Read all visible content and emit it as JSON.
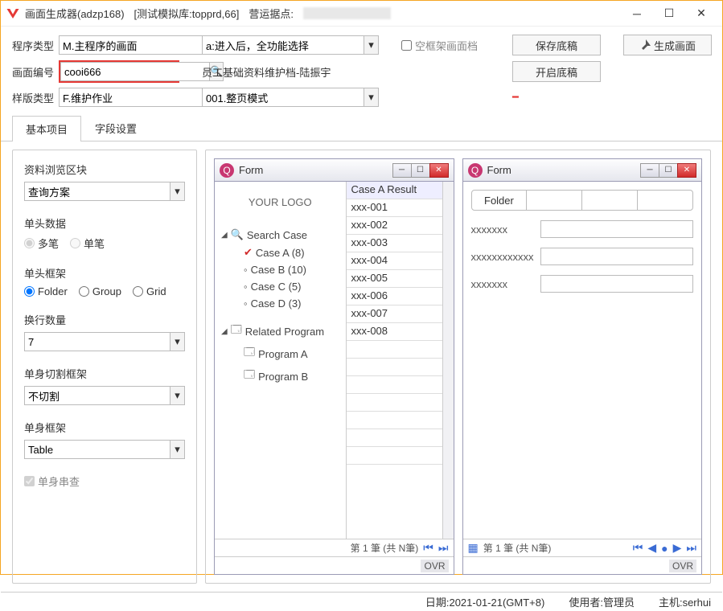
{
  "title": "画面生成器(adzp168)",
  "title_info1": "[测试模拟库:topprd,66]",
  "title_info2": "营运据点:",
  "form": {
    "progtype_lbl": "程序类型",
    "progtype_val": "M.主程序的画面",
    "entry_val": "a:进入后，全功能选择",
    "chk_empty": "空框架画面档",
    "btn_savedraft": "保存底稿",
    "btn_gen": "生成画面",
    "scrno_lbl": "画面编号",
    "scrno_val": "cooi666",
    "staff_lbl": "员工基础资料维护档-陆振宇",
    "btn_opendraft": "开启底稿",
    "tpltype_lbl": "样版类型",
    "tpltype_val": "F.维护作业",
    "pagemode_val": "001.整页模式"
  },
  "tabs": {
    "t1": "基本项目",
    "t2": "字段设置"
  },
  "left": {
    "g1": "资料浏览区块",
    "g1v": "查询方案",
    "g2": "单头数据",
    "r_multi": "多笔",
    "r_single": "单笔",
    "g3": "单头框架",
    "r_folder": "Folder",
    "r_group": "Group",
    "r_grid": "Grid",
    "g4": "换行数量",
    "g4v": "7",
    "g5": "单身切割框架",
    "g5v": "不切割",
    "g6": "单身框架",
    "g6v": "Table",
    "chk_concat": "单身串查"
  },
  "pv": {
    "form_title": "Form",
    "your_logo": "YOUR LOGO",
    "search_case": "Search Case",
    "caseA": "Case A (8)",
    "caseB": "Case B (10)",
    "caseC": "Case C (5)",
    "caseD": "Case D (3)",
    "related": "Related Program",
    "progA": "Program A",
    "progB": "Program B",
    "list_hd": "Case A Result",
    "list_items": [
      "xxx-001",
      "xxx-002",
      "xxx-003",
      "xxx-004",
      "xxx-005",
      "xxx-006",
      "xxx-007",
      "xxx-008"
    ],
    "folder_tab": "Folder",
    "f1": "xxxxxxx",
    "f2": "xxxxxxxxxxxx",
    "f3": "xxxxxxx",
    "pager1": "第 1 筆 (共 N筆)",
    "pager2": "第 1 筆 (共  N筆)",
    "ovr": "OVR"
  },
  "status": {
    "date": "日期:2021-01-21(GMT+8)",
    "user": "使用者:管理员",
    "host": "主机:serhui"
  }
}
